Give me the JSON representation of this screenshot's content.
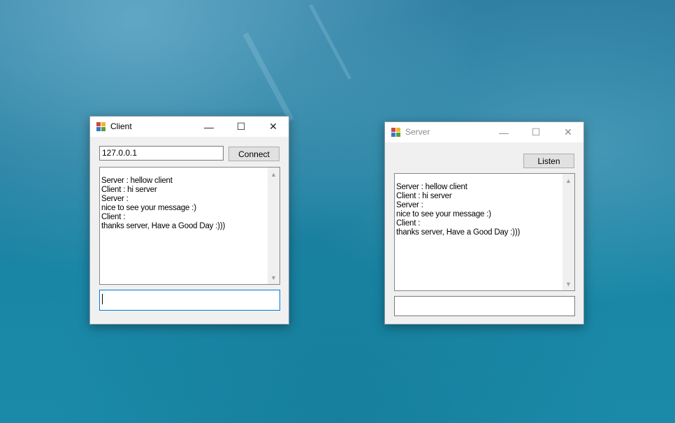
{
  "client": {
    "title": "Client",
    "ip_value": "127.0.0.1",
    "connect_label": "Connect",
    "log": [
      "Server : hellow client",
      "Client : hi server",
      "Server :",
      "nice to see your message :)",
      "Client :",
      "thanks server, Have a Good Day :)))"
    ],
    "message_value": ""
  },
  "server": {
    "title": "Server",
    "listen_label": "Listen",
    "log": [
      "Server : hellow client",
      "Client : hi server",
      "Server :",
      "nice to see your message :)",
      "Client :",
      "thanks server, Have a Good Day :)))"
    ],
    "message_value": ""
  },
  "titlebar_buttons": {
    "minimize": "—",
    "maximize": "☐",
    "close": "✕"
  },
  "scroll_arrows": {
    "up": "▲",
    "down": "▼"
  },
  "colors": {
    "window_bg": "#f0f0f0",
    "focus_border": "#0078d7",
    "desktop_blue": "#1f7a9c"
  },
  "icons": [
    "app-icon",
    "minimize-icon",
    "maximize-icon",
    "close-icon",
    "scroll-up-icon",
    "scroll-down-icon"
  ]
}
